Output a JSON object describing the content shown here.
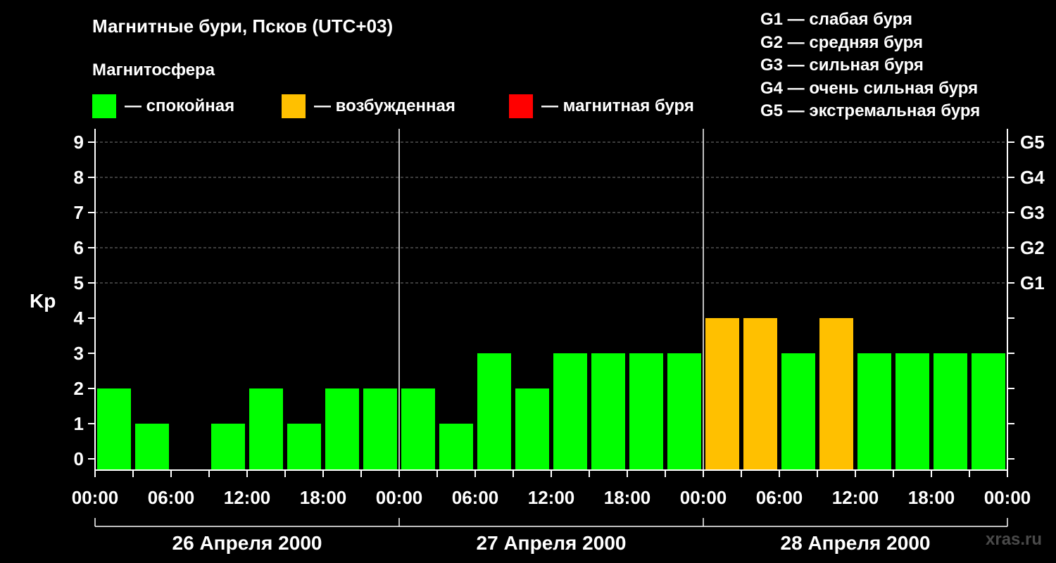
{
  "title": "Магнитные бури, Псков (UTC+03)",
  "subtitle": "Магнитосфера",
  "legend": [
    {
      "label": "— спокойная",
      "color": "#00ff00"
    },
    {
      "label": "— возбужденная",
      "color": "#ffc000"
    },
    {
      "label": "— магнитная буря",
      "color": "#ff0000"
    }
  ],
  "g_legend": [
    "G1 — слабая буря",
    "G2 — средняя буря",
    "G3 — сильная буря",
    "G4 — очень сильная буря",
    "G5 — экстремальная буря"
  ],
  "watermark": "xras.ru",
  "chart_data": {
    "type": "bar",
    "ylabel": "Kp",
    "ylim": [
      0,
      9
    ],
    "yticks": [
      "0",
      "1",
      "2",
      "3",
      "4",
      "5",
      "6",
      "7",
      "8",
      "9"
    ],
    "right_ticks": [
      {
        "value": 5,
        "label": "G1"
      },
      {
        "value": 6,
        "label": "G2"
      },
      {
        "value": 7,
        "label": "G3"
      },
      {
        "value": 8,
        "label": "G4"
      },
      {
        "value": 9,
        "label": "G5"
      }
    ],
    "xtick_labels": [
      "00:00",
      "06:00",
      "12:00",
      "18:00",
      "00:00",
      "06:00",
      "12:00",
      "18:00",
      "00:00",
      "06:00",
      "12:00",
      "18:00",
      "00:00"
    ],
    "days": [
      "26 Апреля 2000",
      "27 Апреля 2000",
      "28 Апреля 2000"
    ],
    "categories": [
      "26 Апреля 2000 00:00",
      "26 Апреля 2000 03:00",
      "26 Апреля 2000 06:00",
      "26 Апреля 2000 09:00",
      "26 Апреля 2000 12:00",
      "26 Апреля 2000 15:00",
      "26 Апреля 2000 18:00",
      "26 Апреля 2000 21:00",
      "27 Апреля 2000 00:00",
      "27 Апреля 2000 03:00",
      "27 Апреля 2000 06:00",
      "27 Апреля 2000 09:00",
      "27 Апреля 2000 12:00",
      "27 Апреля 2000 15:00",
      "27 Апреля 2000 18:00",
      "27 Апреля 2000 21:00",
      "28 Апреля 2000 00:00",
      "28 Апреля 2000 03:00",
      "28 Апреля 2000 06:00",
      "28 Апреля 2000 09:00",
      "28 Апреля 2000 12:00",
      "28 Апреля 2000 15:00",
      "28 Апреля 2000 18:00",
      "28 Апреля 2000 21:00"
    ],
    "values": [
      2,
      1,
      0,
      1,
      2,
      1,
      2,
      2,
      2,
      1,
      3,
      2,
      3,
      3,
      3,
      3,
      4,
      4,
      3,
      4,
      3,
      3,
      3,
      3
    ],
    "status": [
      "спокойная",
      "спокойная",
      "спокойная",
      "спокойная",
      "спокойная",
      "спокойная",
      "спокойная",
      "спокойная",
      "спокойная",
      "спокойная",
      "спокойная",
      "спокойная",
      "спокойная",
      "спокойная",
      "спокойная",
      "спокойная",
      "возбужденная",
      "возбужденная",
      "спокойная",
      "возбужденная",
      "спокойная",
      "спокойная",
      "спокойная",
      "спокойная"
    ],
    "grid": true
  }
}
